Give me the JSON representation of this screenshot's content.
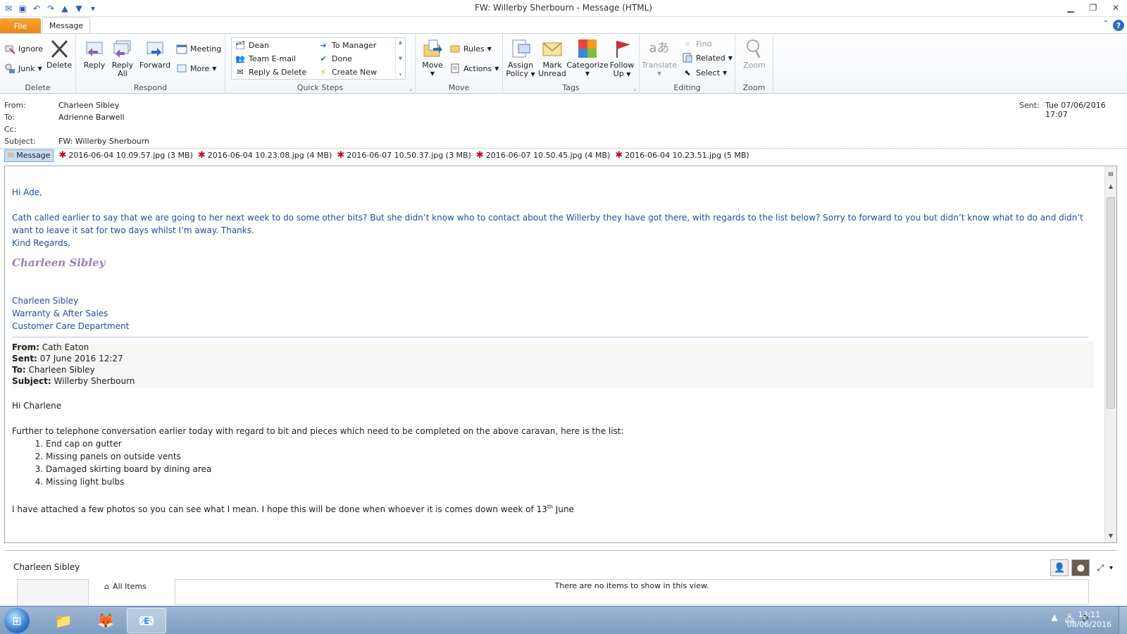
{
  "window": {
    "title": "FW: Willerby Sherbourn  - Message (HTML)"
  },
  "tabs": {
    "file": "File",
    "message": "Message"
  },
  "ribbon": {
    "delete_group": {
      "label": "Delete",
      "ignore": "Ignore",
      "junk": "Junk",
      "delete": "Delete"
    },
    "respond_group": {
      "label": "Respond",
      "reply": "Reply",
      "reply_all_1": "Reply",
      "reply_all_2": "All",
      "forward": "Forward",
      "meeting": "Meeting",
      "more": "More"
    },
    "quicksteps_group": {
      "label": "Quick Steps",
      "items": [
        "Dean",
        "Team E-mail",
        "Reply & Delete",
        "To Manager",
        "Done",
        "Create New"
      ]
    },
    "move_group": {
      "label": "Move",
      "move": "Move",
      "rules": "Rules",
      "actions": "Actions"
    },
    "tags_group": {
      "label": "Tags",
      "assign_1": "Assign",
      "assign_2": "Policy",
      "mark_1": "Mark",
      "mark_2": "Unread",
      "categorize": "Categorize",
      "follow_1": "Follow",
      "follow_2": "Up"
    },
    "editing_group": {
      "label": "Editing",
      "translate": "Translate",
      "find": "Find",
      "related": "Related",
      "select": "Select"
    },
    "zoom_group": {
      "label": "Zoom",
      "zoom": "Zoom"
    }
  },
  "headers": {
    "from_label": "From:",
    "from": "Charleen Sibley",
    "to_label": "To:",
    "to": "Adrienne Barwell",
    "cc_label": "Cc:",
    "subject_label": "Subject:",
    "subject": "FW: Willerby Sherbourn",
    "sent_label": "Sent:",
    "sent": "Tue 07/06/2016 17:07"
  },
  "attachments": {
    "message_tab": "Message",
    "files": [
      "2016-06-04 10.09.57.jpg (3 MB)",
      "2016-06-04 10.23.08.jpg (4 MB)",
      "2016-06-07 10.50.37.jpg (3 MB)",
      "2016-06-07 10.50.45.jpg (4 MB)",
      "2016-06-04 10.23.51.jpg (5 MB)"
    ]
  },
  "body": {
    "greeting": "Hi Ade,",
    "para": "Cath called earlier to say that we are going to her next week to do some other bits? But she didn’t know who to contact about the Willerby they have got there, with regards to the list below?  Sorry to forward to you but didn’t know what to do and didn’t want to leave it sat for two days whilst I’m away.  Thanks.",
    "regards": "Kind Regards,",
    "signature_script": "Charleen Sibley",
    "sig_name": "Charleen Sibley",
    "sig_role": "Warranty & After Sales",
    "sig_dept": "Customer Care Department",
    "fwd_from_label": "From:",
    "fwd_from": "Cath Eaton",
    "fwd_sent_label": "Sent:",
    "fwd_sent": "07 June 2016 12:27",
    "fwd_to_label": "To:",
    "fwd_to": "Charleen Sibley",
    "fwd_subject_label": "Subject:",
    "fwd_subject": "Willerby Sherbourn",
    "fwd_greeting": "Hi Charlene",
    "fwd_para": "Further to telephone conversation earlier today with regard to bit and pieces which need to be completed on the above caravan, here is the list:",
    "list": [
      "End cap on gutter",
      "Missing panels on outside vents",
      "Damaged skirting board by dining area",
      "Missing light bulbs"
    ],
    "closing_pre": "I have attached a few photos so you can see what I mean.  I hope this will be done when whoever it is comes down week of 13",
    "closing_sup": "th",
    "closing_post": " June"
  },
  "people_pane": {
    "name": "Charleen Sibley",
    "all_items": "All Items",
    "empty": "There are no items to show in this view."
  },
  "taskbar": {
    "time": "13:11",
    "date": "08/06/2016"
  },
  "colors": {
    "accent_blue": "#1f4e96",
    "file_tab": "#ec8210",
    "signature": "#9a7fb5"
  }
}
